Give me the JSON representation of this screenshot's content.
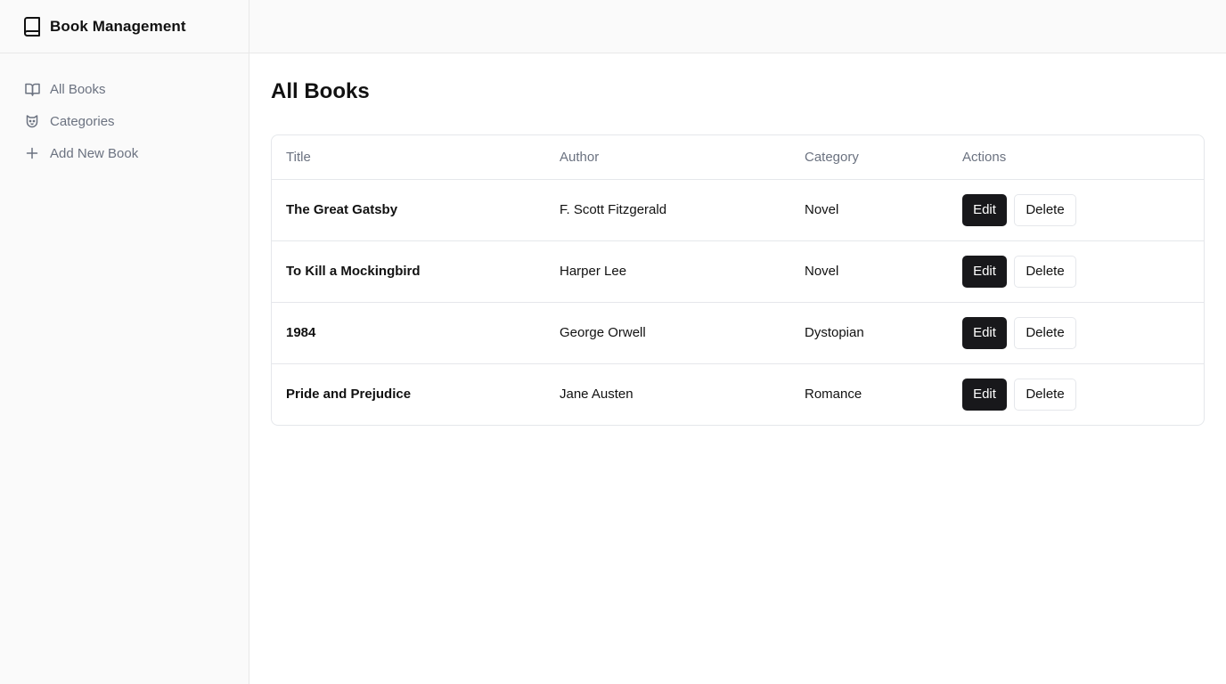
{
  "app": {
    "brand_title": "Book Management",
    "brand_icon": "book-icon"
  },
  "sidebar": {
    "items": [
      {
        "label": "All Books",
        "icon": "book-open-icon"
      },
      {
        "label": "Categories",
        "icon": "categories-icon"
      },
      {
        "label": "Add New Book",
        "icon": "plus-icon"
      }
    ]
  },
  "main": {
    "page_title": "All Books",
    "table": {
      "headers": [
        "Title",
        "Author",
        "Category",
        "Actions"
      ],
      "rows": [
        {
          "title": "The Great Gatsby",
          "author": "F. Scott Fitzgerald",
          "category": "Novel",
          "edit": "Edit",
          "delete": "Delete"
        },
        {
          "title": "To Kill a Mockingbird",
          "author": "Harper Lee",
          "category": "Novel",
          "edit": "Edit",
          "delete": "Delete"
        },
        {
          "title": "1984",
          "author": "George Orwell",
          "category": "Dystopian",
          "edit": "Edit",
          "delete": "Delete"
        },
        {
          "title": "Pride and Prejudice",
          "author": "Jane Austen",
          "category": "Romance",
          "edit": "Edit",
          "delete": "Delete"
        }
      ]
    }
  },
  "colors": {
    "primary_button": "#18181b",
    "muted_text": "#6b7280",
    "border": "#e5e7eb",
    "sidebar_bg": "#fafafa"
  }
}
